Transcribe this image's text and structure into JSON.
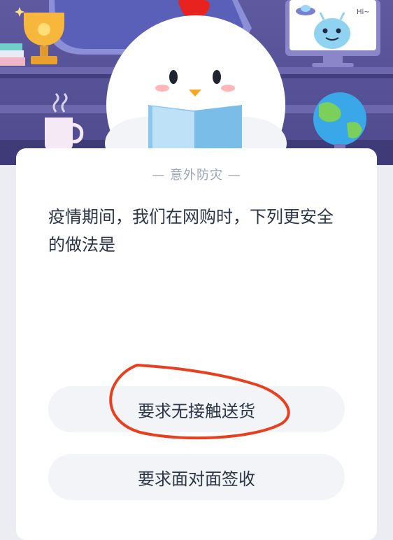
{
  "question": {
    "category": "— 意外防灾 —",
    "text": "疫情期间，我们在网购时，下列更安全的做法是"
  },
  "options": [
    {
      "label": "要求无接触送货"
    },
    {
      "label": "要求面对面签收"
    }
  ],
  "illustration": {
    "monitor_text": "Hi~",
    "icons": [
      "trophy-icon",
      "mascot-chicken",
      "globe-icon",
      "mug-icon",
      "alien-icon",
      "ufo-icon"
    ]
  },
  "colors": {
    "hero_bg": "#5b5699",
    "annotation": "#e8401f",
    "text": "#2c3447",
    "muted": "#9aa3b8",
    "option_bg": "#f2f4f7"
  }
}
